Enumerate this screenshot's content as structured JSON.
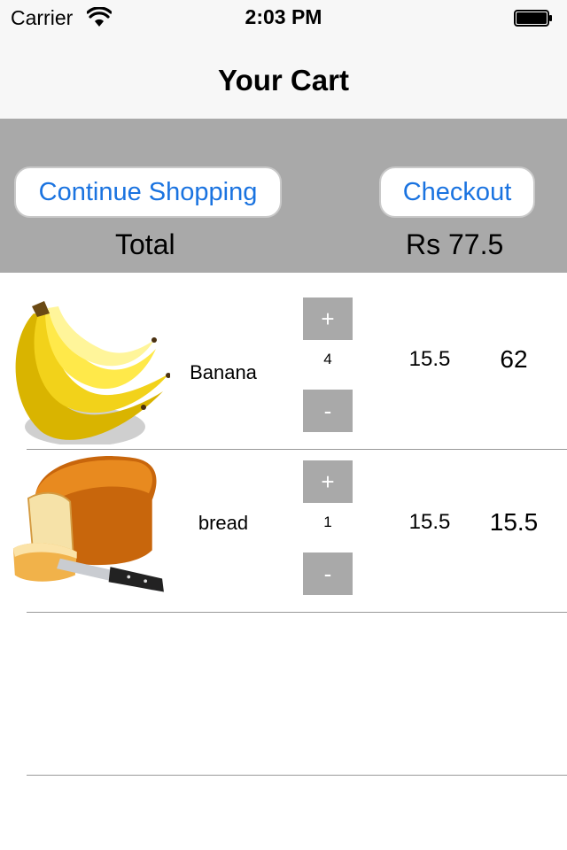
{
  "status_bar": {
    "carrier": "Carrier",
    "time": "2:03 PM",
    "icons": [
      "wifi-icon",
      "battery-icon"
    ]
  },
  "nav": {
    "title": "Your Cart"
  },
  "summary": {
    "continue_label": "Continue Shopping",
    "checkout_label": "Checkout",
    "total_label": "Total",
    "total_value": "Rs 77.5"
  },
  "cart": {
    "items": [
      {
        "name": "Banana",
        "qty": "4",
        "price": "15.5",
        "subtotal": "62",
        "plus": "+",
        "minus": "-",
        "image": "banana-image"
      },
      {
        "name": "bread",
        "qty": "1",
        "price": "15.5",
        "subtotal": "15.5",
        "plus": "+",
        "minus": "-",
        "image": "bread-image"
      }
    ]
  },
  "colors": {
    "accent": "#1a73e0",
    "header_bg": "#a9a9a9",
    "bar_bg": "#f7f7f7"
  }
}
